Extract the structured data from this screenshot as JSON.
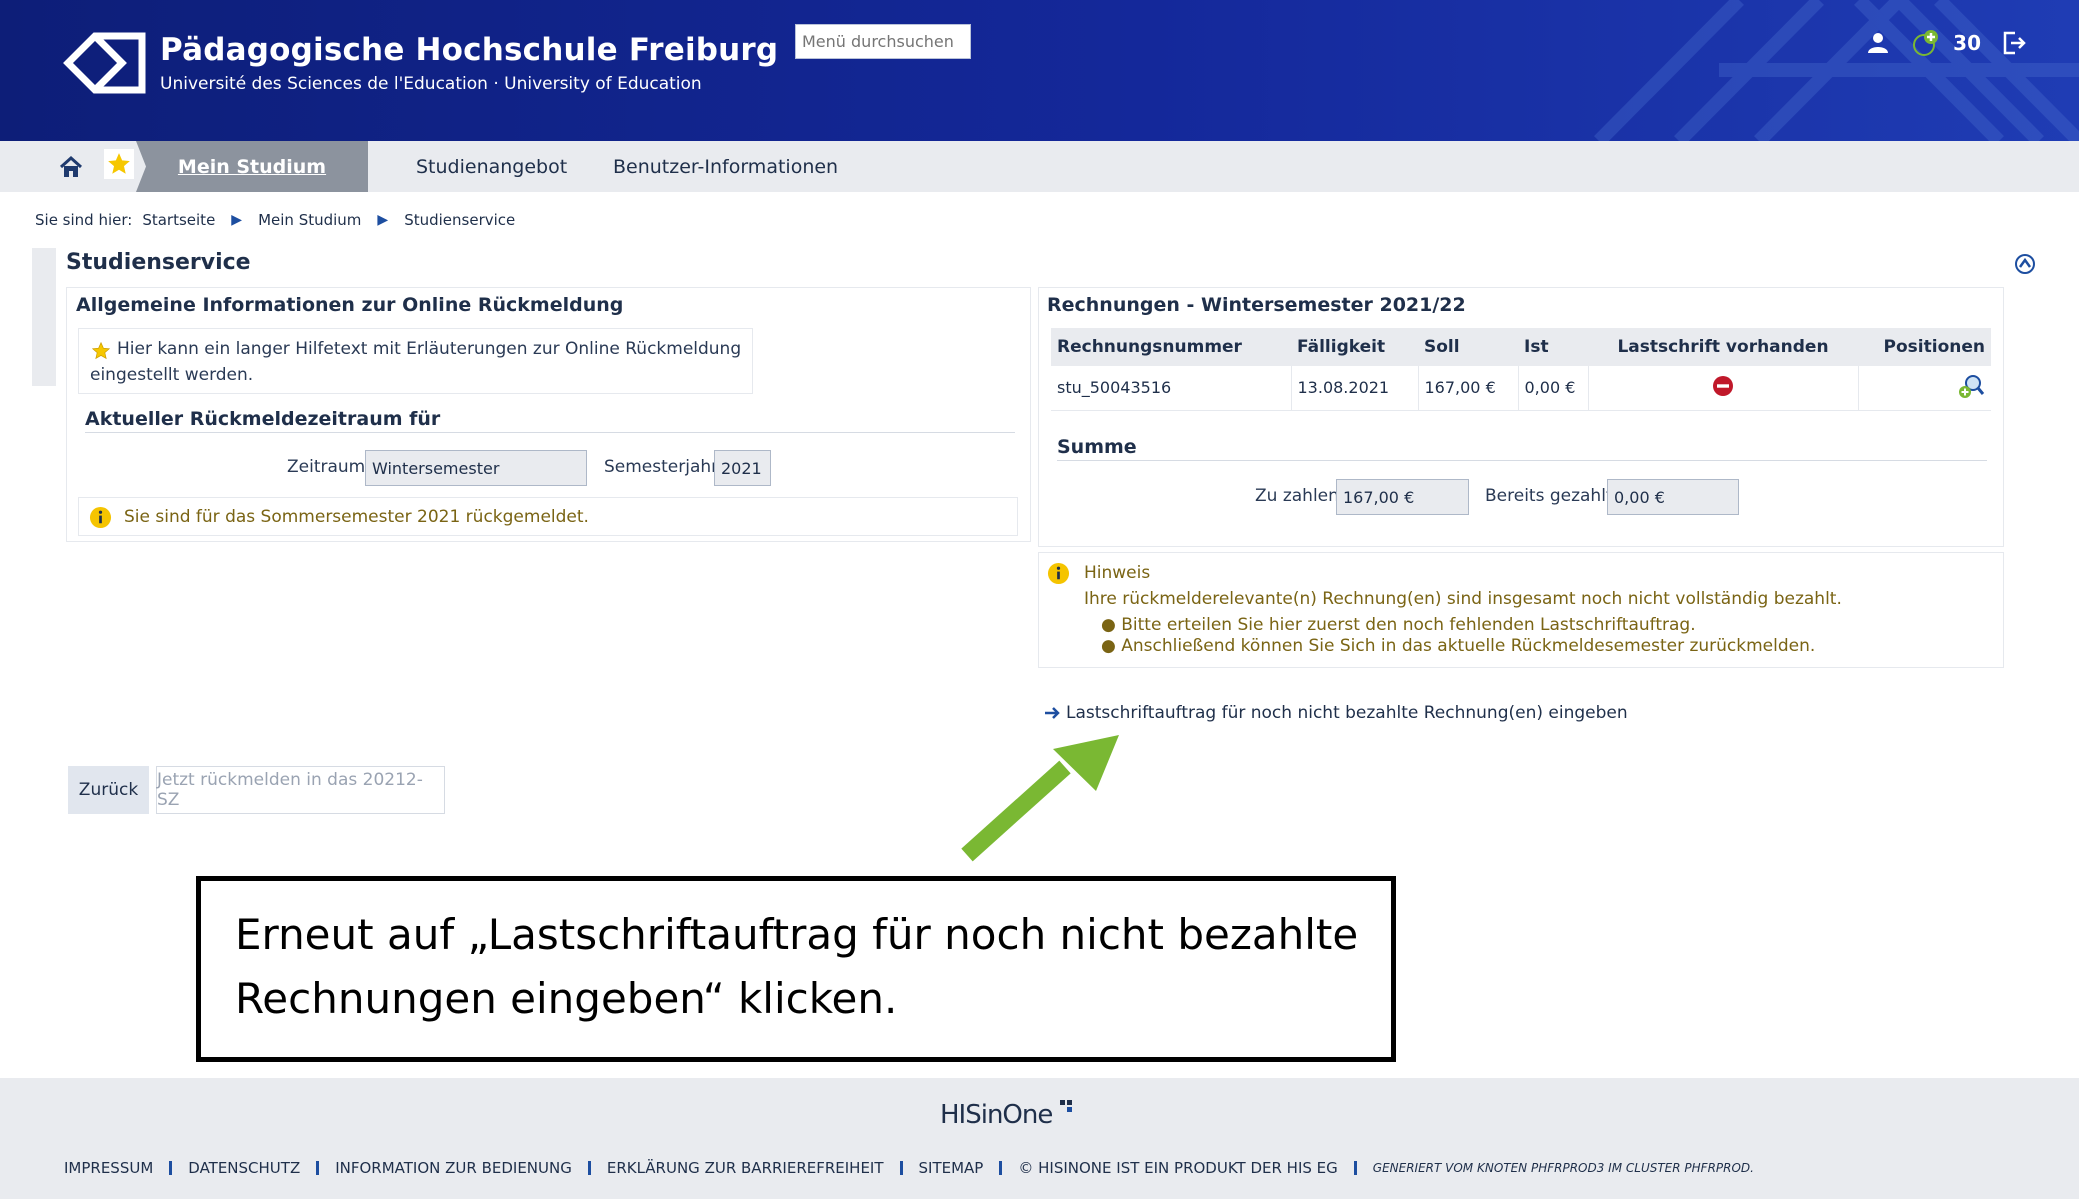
{
  "header": {
    "title": "Pädagogische Hochschule Freiburg",
    "subtitle": "Université des Sciences de l'Education · University of Education",
    "search_placeholder": "Menü durchsuchen",
    "notification_count": "30"
  },
  "nav": {
    "active": "Mein Studium",
    "items": [
      "Studienangebot",
      "Benutzer-Informationen"
    ]
  },
  "breadcrumb": {
    "prefix": "Sie sind hier:",
    "items": [
      "Startseite",
      "Mein Studium",
      "Studienservice"
    ]
  },
  "section": {
    "title": "Studienservice"
  },
  "left_panel": {
    "title": "Allgemeine Informationen zur Online Rückmeldung",
    "help_line1": "Hier kann ein langer Hilfetext mit Erläuterungen zur Online Rückmeldung",
    "help_line2": "eingestellt werden.",
    "period_title": "Aktueller Rückmeldezeitraum für",
    "zeitraum_label": "Zeitraum",
    "zeitraum_value": "Wintersemester",
    "semesterjahr_label": "Semesterjahr",
    "semesterjahr_value": "2021",
    "info": "Sie sind für das Sommersemester 2021 rückgemeldet."
  },
  "right_panel": {
    "title": "Rechnungen - Wintersemester 2021/22",
    "columns": [
      "Rechnungsnummer",
      "Fälligkeit",
      "Soll",
      "Ist",
      "Lastschrift vorhanden",
      "Positionen"
    ],
    "rows": [
      {
        "number": "stu_50043516",
        "due": "13.08.2021",
        "soll": "167,00 €",
        "ist": "0,00 €"
      }
    ],
    "sum_title": "Summe",
    "zu_zahlen_label": "Zu zahlen",
    "zu_zahlen_value": "167,00 €",
    "bereits_label": "Bereits gezahlt",
    "bereits_value": "0,00 €"
  },
  "hinweis": {
    "title": "Hinweis",
    "text": "Ihre rückmelderelevante(n) Rechnung(en) sind insgesamt noch nicht vollständig bezahlt.",
    "bullets": [
      "Bitte erteilen Sie hier zuerst den noch fehlenden Lastschriftauftrag.",
      "Anschließend können Sie Sich in das aktuelle Rückmeldesemester zurückmelden."
    ]
  },
  "link": {
    "label": "Lastschriftauftrag für noch nicht bezahlte Rechnung(en) eingeben"
  },
  "buttons": {
    "back": "Zurück",
    "register": "Jetzt rückmelden in das 20212-SZ"
  },
  "callout": {
    "text": "Erneut auf „Lastschriftauftrag für noch nicht bezahlte Rechnungen eingeben“ klicken."
  },
  "footer": {
    "logo": "HISinOne",
    "links": [
      "IMPRESSUM",
      "DATENSCHUTZ",
      "INFORMATION ZUR BEDIENUNG",
      "ERKLÄRUNG ZUR BARRIEREFREIHEIT",
      "SITEMAP",
      "© HISINONE IST EIN PRODUKT DER HIS EG"
    ],
    "generated": "GENERIERT VOM KNOTEN PHFRPROD3 IM CLUSTER PHFRPROD."
  },
  "colors": {
    "header": "#14289a",
    "accent": "#1d4ea0",
    "arrow": "#7ab833",
    "info": "#f5c400",
    "stop": "#c0182a"
  }
}
